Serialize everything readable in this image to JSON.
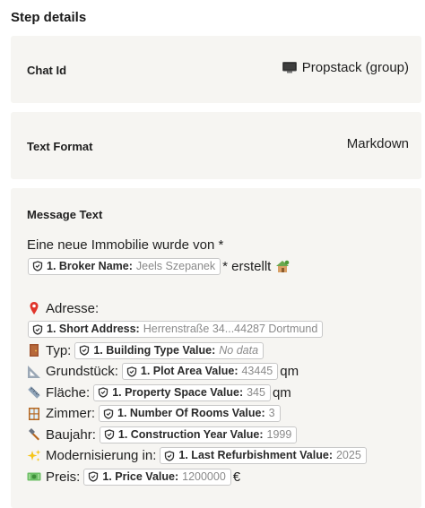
{
  "page_title": "Step details",
  "chat_id": {
    "label": "Chat Id",
    "icon": "monitor-icon",
    "value": "Propstack (group)"
  },
  "text_format": {
    "label": "Text Format",
    "value": "Markdown"
  },
  "message_text": {
    "label": "Message Text",
    "intro": "Eine neue Immobilie wurde von *",
    "broker": {
      "label": "1. Broker Name:",
      "value": "Jeels Szepanek"
    },
    "created": "* erstellt",
    "created_icon": "house-icon",
    "rows": [
      {
        "icon": "pin-icon",
        "text": "Adresse:",
        "pill": null,
        "suffix": ""
      },
      {
        "icon": null,
        "text": "",
        "pill": {
          "label": "1. Short Address:",
          "value": "Herrenstraße 34...44287 Dortmund"
        },
        "suffix": ""
      },
      {
        "icon": "door-icon",
        "text": "Typ:",
        "pill": {
          "label": "1. Building Type Value:",
          "value": "No data"
        },
        "suffix": ""
      },
      {
        "icon": "triangle-ruler-icon",
        "text": "Grundstück:",
        "pill": {
          "label": "1. Plot Area Value:",
          "value": "43445"
        },
        "suffix": "qm"
      },
      {
        "icon": "ruler-icon",
        "text": "Fläche:",
        "pill": {
          "label": "1. Property Space Value:",
          "value": "345"
        },
        "suffix": "qm"
      },
      {
        "icon": "window-icon",
        "text": "Zimmer:",
        "pill": {
          "label": "1. Number Of Rooms Value:",
          "value": "3"
        },
        "suffix": ""
      },
      {
        "icon": "hammer-icon",
        "text": "Baujahr:",
        "pill": {
          "label": "1. Construction Year Value:",
          "value": "1999"
        },
        "suffix": ""
      },
      {
        "icon": "sparkles-icon",
        "text": "Modernisierung in:",
        "pill": {
          "label": "1. Last Refurbishment Value:",
          "value": "2025"
        },
        "suffix": ""
      },
      {
        "icon": "money-icon",
        "text": "Preis:",
        "pill": {
          "label": "1. Price Value:",
          "value": "1200000"
        },
        "suffix": "€"
      }
    ]
  },
  "colors": {
    "card_bg": "#f6f5f2",
    "pill_border": "#c8c8c8",
    "muted": "#8a8a8a"
  }
}
